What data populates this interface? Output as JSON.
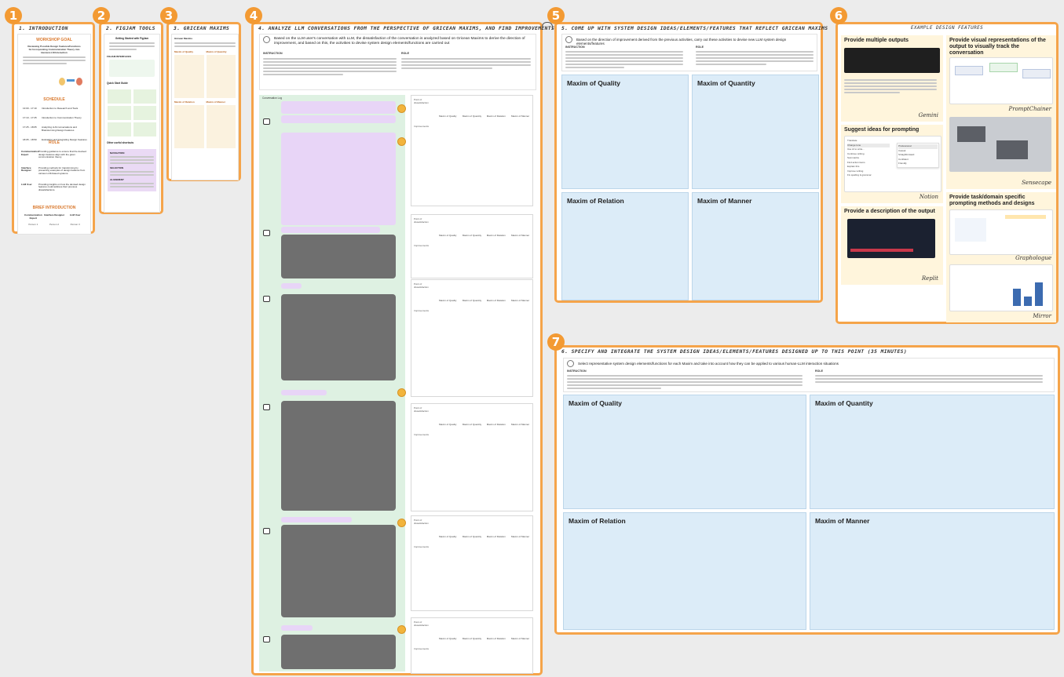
{
  "frames": {
    "f1": {
      "num": "1",
      "title": "1. Introduction"
    },
    "f2": {
      "num": "2",
      "title": "2. FigJam Tools"
    },
    "f3": {
      "num": "3",
      "title": "3. Gricean Maxims"
    },
    "f4": {
      "num": "4",
      "title": "4. Analyze LLM conversations from the perspective of Gricean maxims, and find improvements"
    },
    "f5": {
      "num": "5",
      "title": "5. Come up with system design ideas/elements/features that reflect Gricean maxims"
    },
    "f6": {
      "num": "6",
      "title": "Example Design Features"
    },
    "f7": {
      "num": "7",
      "title": "6. Specify and integrate the system design ideas/elements/features designed up to this point (35 minutes)"
    }
  },
  "intro": {
    "goal": "WORKSHOP GOAL",
    "goal_text": "Reviewing Possible Design Features/Functions for Incorporating Communication Theory into Human-LLM Interaction",
    "schedule": "SCHEDULE",
    "rows": [
      {
        "time": "13:00 - 17:10",
        "desc": "Introduction to Research and Tools"
      },
      {
        "time": "17:10 - 17:25",
        "desc": "Introduction to Communication Theory"
      },
      {
        "time": "17:25 - 18:05",
        "desc": "Analyzing LLM conversations and Brainstorming Design Features"
      },
      {
        "time": "18:05 - 18:50",
        "desc": "Evaluating and Integrating Design Features"
      }
    ],
    "role": "ROLE",
    "roles": [
      {
        "name": "Communication Expert",
        "desc": "Providing guidance to ensure that the devised design features align with the given communication theory."
      },
      {
        "name": "Interface Designer",
        "desc": "Providing methods for transforming by presenting examples of design features from various LLM-based systems."
      },
      {
        "name": "LLM User",
        "desc": "Providing insights on how the devised design features could address their previous dissatisfactions."
      }
    ],
    "brief": "BRIEF INTRODUCTION",
    "people": [
      "Communication Expert",
      "Interface Designer",
      "LLM User"
    ],
    "persons": [
      "Person 1",
      "Person 2",
      "Person 3"
    ]
  },
  "figjam": {
    "getting_started": "Getting Started with FigJam",
    "figjam_interfaces": "FIGJAM INTERFACES",
    "quick_start": "Quick Start Guide",
    "other_useful": "Other useful shortcuts",
    "movement": "NAVIGATION",
    "selection": "SELECTION",
    "alignment": "ALIGNMENT"
  },
  "gricean": {
    "intro": "Gricean Maxims",
    "maxims": [
      "Maxim of Quality",
      "Maxim of Quantity",
      "Maxim of Relation",
      "Maxim of Manner"
    ]
  },
  "analyze": {
    "intro": "Based on the LLM user's conversation with LLM, the dissatisfaction of the conversation is analyzed based on Gricean Maxims to derive the direction of improvement, and based on this, the activities to devise system design elements/functions are carried out",
    "instruction": "INSTRUCTION",
    "role": "ROLE",
    "conversation_label": "Conversation Log",
    "point_label": "Point of dissatisfaction",
    "improve_label": "Improvements",
    "cols": [
      "Maxim of Quality",
      "Maxim of Quantity",
      "Maxim of Relation",
      "Maxim of Manner"
    ]
  },
  "design": {
    "intro": "Based on the direction of improvement derived from the previous activities, carry out these activities to devise new LLM system design elements/features",
    "instruction": "INSTRUCTION",
    "role": "ROLE",
    "boxes": [
      "Maxim of Quality",
      "Maxim of Quantity",
      "Maxim of Relation",
      "Maxim of Manner"
    ]
  },
  "examples": {
    "left": [
      {
        "title": "Provide multiple outputs",
        "tool": "Gemini"
      },
      {
        "title": "Suggest ideas for prompting",
        "tool": "Notion"
      },
      {
        "title": "Provide a description of the output",
        "tool": "Replit"
      }
    ],
    "right": [
      {
        "title": "Provide visual representations of the output to visually track the conversation",
        "tool": "PromptChainer"
      },
      {
        "tool": "Sensecape"
      },
      {
        "title": "Provide task/domain specific prompting methods and designs",
        "tool": "Graphologue"
      },
      {
        "tool": "Mirror"
      }
    ],
    "notion_items": [
      "Translate",
      "Change tone",
      "Use AI to write...",
      "Continue writing",
      "Summarize",
      "Find action items",
      "Explain this",
      "Improve writing",
      "Fix spelling & grammar"
    ],
    "notion_options": [
      "Professional",
      "Casual",
      "Straightforward",
      "Confident",
      "Friendly"
    ]
  },
  "integrate": {
    "intro": "Select representative system design elements/functions for each Maxim and take into account how they can be applied to various human-LLM interaction situations",
    "instruction": "INSTRUCTION",
    "role": "ROLE",
    "boxes": [
      "Maxim of Quality",
      "Maxim of Quantity",
      "Maxim of Relation",
      "Maxim of Manner"
    ]
  },
  "colors": {
    "accent": "#f5a44a",
    "badge": "#f39a33",
    "maxim_box": "#dcecf8",
    "feature_bg": "#fff5dc",
    "conv_bg": "#def1e2",
    "user_msg": "#e8d5f7",
    "llm_msg": "#6f6f6f"
  }
}
